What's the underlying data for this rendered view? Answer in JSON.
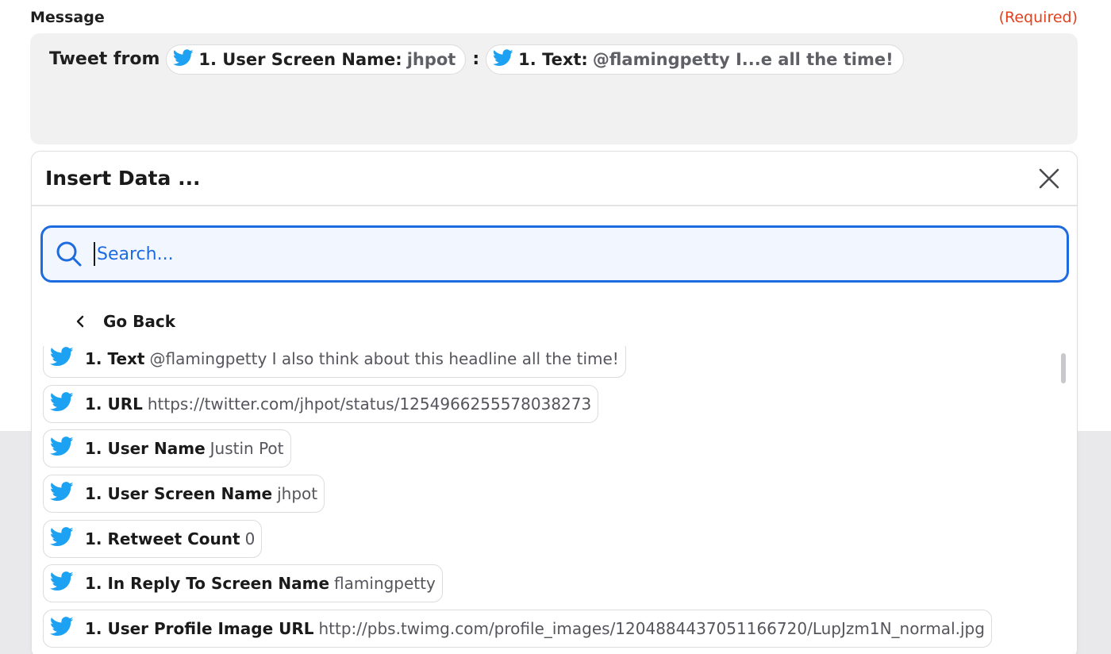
{
  "field": {
    "label": "Message",
    "required": "(Required)"
  },
  "message": {
    "prefix": "Tweet from",
    "separator": ":",
    "tokens": [
      {
        "key": "1. User Screen Name:",
        "value": "jhpot"
      },
      {
        "key": "1. Text:",
        "value": "@flamingpetty I...e all the time!"
      }
    ]
  },
  "panel": {
    "title": "Insert Data ...",
    "search_placeholder": "Search...",
    "go_back": "Go Back"
  },
  "items": [
    {
      "key": "1. Text",
      "value": "@flamingpetty I also think about this headline all the time!"
    },
    {
      "key": "1. URL",
      "value": "https://twitter.com/jhpot/status/1254966255578038273"
    },
    {
      "key": "1. User Name",
      "value": "Justin Pot"
    },
    {
      "key": "1. User Screen Name",
      "value": "jhpot"
    },
    {
      "key": "1. Retweet Count",
      "value": "0"
    },
    {
      "key": "1. In Reply To Screen Name",
      "value": "flamingpetty"
    },
    {
      "key": "1. User Profile Image URL",
      "value": "http://pbs.twimg.com/profile_images/1204884437051166720/LupJzm1N_normal.jpg"
    }
  ],
  "colors": {
    "accent": "#1e6be0",
    "required": "#e0421f",
    "twitter": "#1da1f2"
  },
  "icons": {
    "source": "twitter-bird-icon",
    "search": "search-icon",
    "close": "close-icon",
    "back": "chevron-left-icon"
  }
}
